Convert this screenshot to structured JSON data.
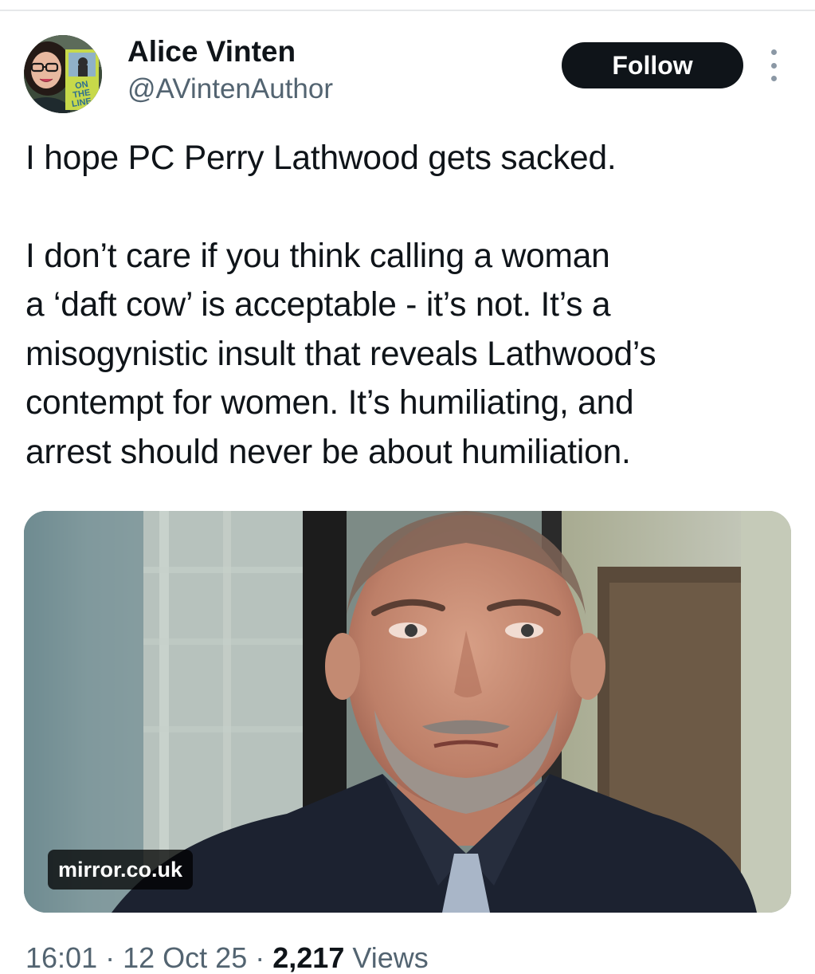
{
  "author": {
    "display_name": "Alice Vinten",
    "handle": "@AVintenAuthor",
    "avatar_icon": "profile-photo-with-book",
    "avatar_book_text": "ON THE LINE"
  },
  "actions": {
    "follow_label": "Follow",
    "more_icon": "more-vertical-icon"
  },
  "tweet": {
    "paragraphs": [
      [
        "I hope PC Perry Lathwood gets sacked."
      ],
      [
        "I don’t care if you think calling a woman",
        "a ‘daft cow’ is acceptable - it’s not. It’s a",
        "misogynistic insult that reveals Lathwood’s",
        "contempt for women. It’s humiliating, and",
        "arrest should never be about humiliation."
      ]
    ]
  },
  "media": {
    "source_label": "mirror.co.uk"
  },
  "meta": {
    "time": "16:01",
    "separator": "·",
    "date": "12 Oct 25",
    "views_count": "2,217",
    "views_label": "Views"
  },
  "colors": {
    "text": "#0f1419",
    "secondary": "#536471",
    "follow_bg": "#0f1419",
    "follow_text": "#ffffff"
  }
}
